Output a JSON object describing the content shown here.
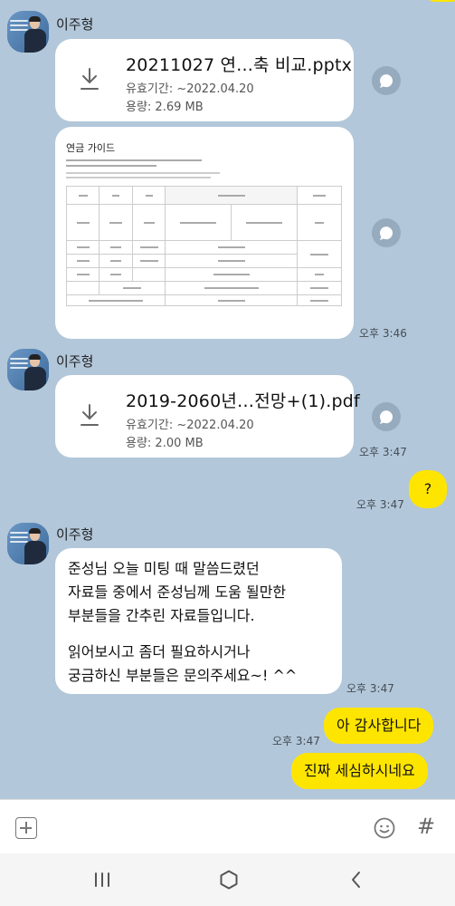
{
  "messages": {
    "sender_name": "이주형",
    "file1": {
      "name": "20211027 연...축 비교.pptx",
      "expiry": "유효기간: ~2022.04.20",
      "size": "용량: 2.69 MB"
    },
    "image_preview": {
      "title": "연금 가이드"
    },
    "time_346": "오후 3:46",
    "file2": {
      "name": "2019-2060년…전망+(1).pdf",
      "expiry": "유효기간: ~2022.04.20",
      "size": "용량: 2.00 MB"
    },
    "time_347_a": "오후 3:47",
    "my_question": "?",
    "time_347_b": "오후 3:47",
    "long_text": {
      "line1": "준성님 오늘 미팅 때 말씀드렸던",
      "line2": "자료들 중에서 준성님께 도움 될만한",
      "line3": "부분들을 간추린 자료들입니다.",
      "line4": "읽어보시고 좀더 필요하시거나",
      "line5": "궁금하신 부분들은 문의주세요~! ^^"
    },
    "time_347_c": "오후 3:47",
    "time_347_d": "오후 3:47",
    "my_reply1": "아 감사합니다",
    "my_reply2": "진짜 세심하시네요"
  },
  "icons": {
    "download": "download-icon",
    "share": "share-icon",
    "plus": "plus-icon",
    "emoji": "emoji-icon",
    "hash": "hash-icon",
    "recent_apps": "recent-apps-icon",
    "home": "home-icon",
    "back": "back-icon"
  },
  "input_bar": {
    "hash_symbol": "#"
  },
  "colors": {
    "background": "#b2c7da",
    "my_bubble": "#fee500",
    "other_bubble": "#ffffff"
  }
}
